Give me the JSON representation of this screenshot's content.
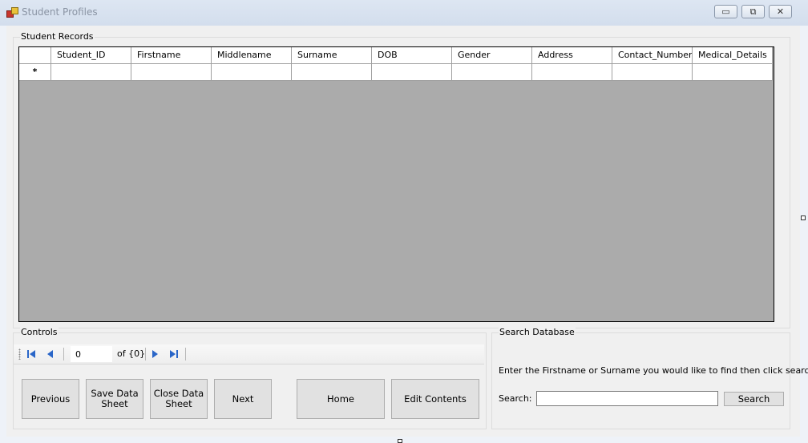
{
  "window": {
    "title": "Student Profiles",
    "minimize_glyph": "▭",
    "maximize_glyph": "⧉",
    "close_glyph": "✕"
  },
  "records": {
    "group_label": "Student Records",
    "columns": [
      "Student_ID",
      "Firstname",
      "Middlename",
      "Surname",
      "DOB",
      "Gender",
      "Address",
      "Contact_Number",
      "Medical_Details"
    ],
    "new_row_marker": "*"
  },
  "controls": {
    "group_label": "Controls",
    "navigator": {
      "position": "0",
      "count_text": "of {0}",
      "first_icon": "move-first-icon",
      "prev_icon": "move-previous-icon",
      "next_icon": "move-next-icon",
      "last_icon": "move-last-icon"
    },
    "buttons": {
      "previous": "Previous",
      "save": "Save Data Sheet",
      "close": "Close Data Sheet",
      "next": "Next",
      "home": "Home",
      "edit": "Edit Contents"
    }
  },
  "search": {
    "group_label": "Search Database",
    "instruction": "Enter the Firstname or Surname you would like to find then click search",
    "label": "Search:",
    "value": "",
    "button": "Search"
  }
}
